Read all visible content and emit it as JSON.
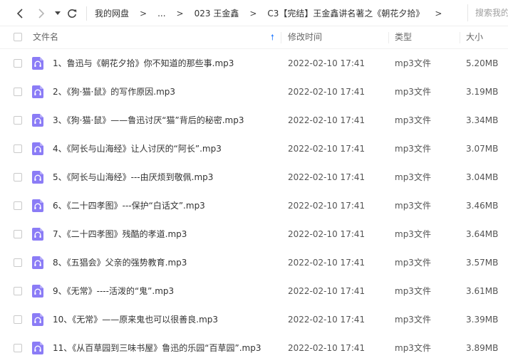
{
  "nav": {
    "back_icon": "chevron-left-icon",
    "forward_icon": "chevron-right-icon",
    "dropdown_icon": "caret-down-icon",
    "refresh_icon": "refresh-icon"
  },
  "breadcrumb": {
    "items": [
      "我的网盘",
      "...",
      "023 王金鑫",
      "C3【完结】王金鑫讲名著之《朝花夕拾》"
    ],
    "separator": ">"
  },
  "search": {
    "placeholder": "搜索我的"
  },
  "table": {
    "columns": {
      "name": "文件名",
      "modified": "修改时间",
      "type": "类型",
      "size": "大小"
    },
    "sort_icon": "sort-up-arrow-icon",
    "rows": [
      {
        "name": "1、鲁迅与《朝花夕拾》你不知道的那些事.mp3",
        "modified": "2022-02-10 17:41",
        "type": "mp3文件",
        "size": "5.20MB"
      },
      {
        "name": "2、《狗·猫·鼠》的写作原因.mp3",
        "modified": "2022-02-10 17:41",
        "type": "mp3文件",
        "size": "3.19MB"
      },
      {
        "name": "3、《狗·猫·鼠》——鲁迅讨厌“猫”背后的秘密.mp3",
        "modified": "2022-02-10 17:41",
        "type": "mp3文件",
        "size": "3.34MB"
      },
      {
        "name": "4、《阿长与山海经》让人讨厌的“阿长”.mp3",
        "modified": "2022-02-10 17:41",
        "type": "mp3文件",
        "size": "3.07MB"
      },
      {
        "name": "5、《阿长与山海经》---由厌烦到敬佩.mp3",
        "modified": "2022-02-10 17:41",
        "type": "mp3文件",
        "size": "3.04MB"
      },
      {
        "name": "6、《二十四孝图》---保护“白话文”.mp3",
        "modified": "2022-02-10 17:41",
        "type": "mp3文件",
        "size": "3.46MB"
      },
      {
        "name": "7、《二十四孝图》残酷的孝道.mp3",
        "modified": "2022-02-10 17:41",
        "type": "mp3文件",
        "size": "3.64MB"
      },
      {
        "name": "8、《五猖会》父亲的强势教育.mp3",
        "modified": "2022-02-10 17:41",
        "type": "mp3文件",
        "size": "3.57MB"
      },
      {
        "name": "9、《无常》----活泼的“鬼”.mp3",
        "modified": "2022-02-10 17:41",
        "type": "mp3文件",
        "size": "3.61MB"
      },
      {
        "name": "10、《无常》——原来鬼也可以很善良.mp3",
        "modified": "2022-02-10 17:41",
        "type": "mp3文件",
        "size": "3.39MB"
      },
      {
        "name": "11、《从百草园到三味书屋》鲁迅的乐园“百草园”.mp3",
        "modified": "2022-02-10 17:41",
        "type": "mp3文件",
        "size": "3.89MB"
      }
    ]
  },
  "colors": {
    "accent": "#2f82ff",
    "file_icon": "#8b7cf6"
  }
}
